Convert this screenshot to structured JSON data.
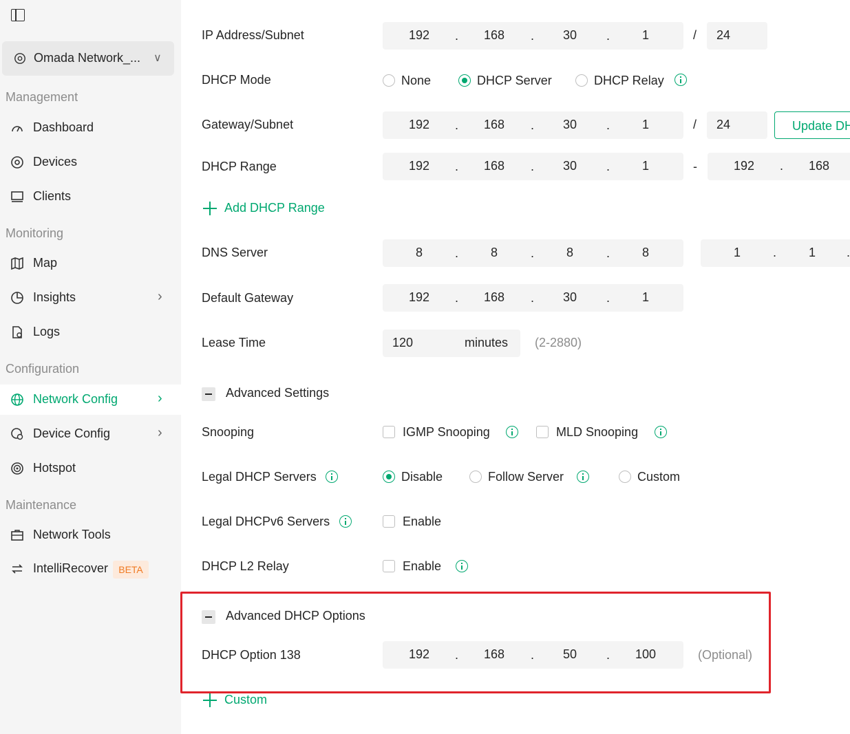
{
  "sidebar": {
    "site_name": "Omada Network_...",
    "sections": {
      "management": "Management",
      "monitoring": "Monitoring",
      "configuration": "Configuration",
      "maintenance": "Maintenance"
    },
    "items": {
      "dashboard": "Dashboard",
      "devices": "Devices",
      "clients": "Clients",
      "map": "Map",
      "insights": "Insights",
      "logs": "Logs",
      "network_config": "Network Config",
      "device_config": "Device Config",
      "hotspot": "Hotspot",
      "network_tools": "Network Tools",
      "intellirecover": "IntelliRecover"
    },
    "beta_badge": "BETA",
    "active_item": "Network Config",
    "accent_color": "#00a870"
  },
  "form": {
    "ip_subnet": {
      "label": "IP Address/Subnet",
      "octets": [
        "192",
        "168",
        "30",
        "1"
      ],
      "mask": "24"
    },
    "dhcp_mode": {
      "label": "DHCP Mode",
      "options": [
        "None",
        "DHCP Server",
        "DHCP Relay"
      ],
      "selected": "DHCP Server"
    },
    "gateway_subnet": {
      "label": "Gateway/Subnet",
      "octets": [
        "192",
        "168",
        "30",
        "1"
      ],
      "mask": "24",
      "button": "Update DH"
    },
    "dhcp_range": {
      "label": "DHCP Range",
      "start": [
        "192",
        "168",
        "30",
        "1"
      ],
      "end_partial": [
        "192",
        "168"
      ],
      "dash": "-"
    },
    "add_dhcp_range": "Add DHCP Range",
    "dns_server": {
      "label": "DNS Server",
      "primary": [
        "8",
        "8",
        "8",
        "8"
      ],
      "secondary_partial": [
        "1",
        "1"
      ]
    },
    "default_gateway": {
      "label": "Default Gateway",
      "octets": [
        "192",
        "168",
        "30",
        "1"
      ]
    },
    "lease_time": {
      "label": "Lease Time",
      "value": "120",
      "unit": "minutes",
      "range": "(2-2880)"
    },
    "advanced_settings": "Advanced Settings",
    "snooping": {
      "label": "Snooping",
      "igmp": "IGMP Snooping",
      "mld": "MLD Snooping"
    },
    "legal_dhcp_servers": {
      "label": "Legal DHCP Servers",
      "options": [
        "Disable",
        "Follow Server",
        "Custom"
      ],
      "selected": "Disable"
    },
    "legal_dhcpv6_servers": {
      "label": "Legal DHCPv6 Servers",
      "option": "Enable"
    },
    "dhcp_l2_relay": {
      "label": "DHCP L2 Relay",
      "option": "Enable"
    },
    "advanced_dhcp_options": "Advanced DHCP Options",
    "dhcp_option_138": {
      "label": "DHCP Option 138",
      "octets": [
        "192",
        "168",
        "50",
        "100"
      ],
      "hint": "(Optional)"
    },
    "custom_link": "Custom",
    "slash": "/",
    "dot": "."
  },
  "highlight_color": "#e0242c"
}
